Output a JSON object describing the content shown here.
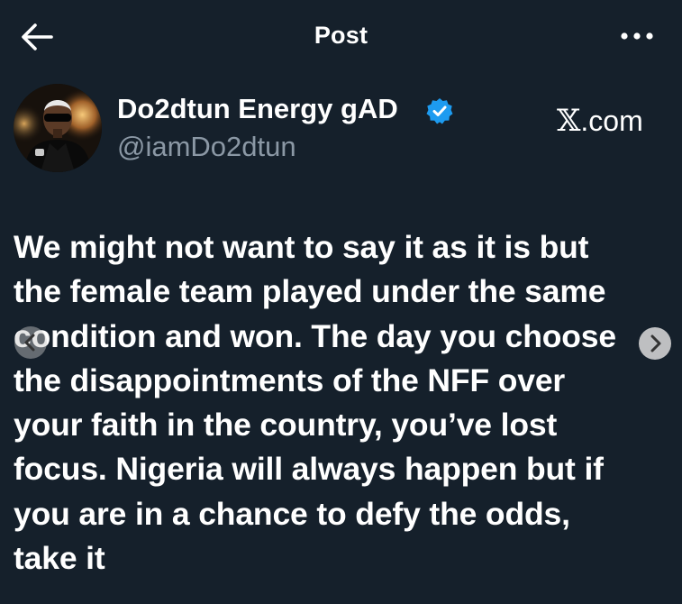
{
  "header": {
    "title": "Post",
    "back_icon": "arrow-left-icon",
    "more_icon": "more-horizontal-icon"
  },
  "author": {
    "name": "Do2dtun Energy gAD",
    "handle": "@iamDo2dtun",
    "verified": true,
    "verified_color": "#1d9bf0"
  },
  "brand": {
    "glyph": "𝕏",
    "suffix": ".com"
  },
  "post": {
    "lines": [
      "We might not want to say it as it is but",
      "the female team played under the same",
      "condition and won. The day you choose",
      "the disappointments of the NFF over",
      "your faith in the country, you’ve lost",
      "focus. Nigeria will always happen but if",
      "you are in a chance to defy the odds,",
      "take it"
    ]
  },
  "carousel": {
    "prev_icon": "chevron-left-icon",
    "next_icon": "chevron-right-icon"
  },
  "colors": {
    "background": "#15202b",
    "text": "#ffffff",
    "secondary_text": "#8b98a5"
  }
}
